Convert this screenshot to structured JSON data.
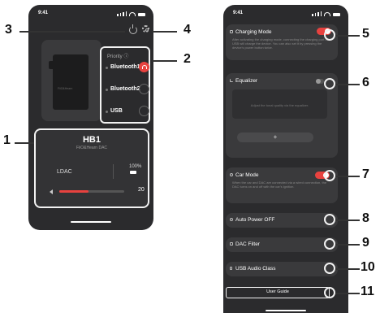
{
  "left_phone": {
    "status_time": "9:41",
    "priority_title": "Priority ⓘ",
    "priority_items": [
      "Bluetooth1",
      "Bluetooth2",
      "USB"
    ],
    "device": {
      "model": "HB1",
      "brand": "FiiO&Hearn DAC",
      "codec": "LDAC",
      "battery": "100%",
      "volume": "20",
      "volume_fraction": 0.45,
      "device_label": "FiiO&Hearn"
    }
  },
  "right_phone": {
    "status_time": "9:41",
    "charging": {
      "title": "Charging Mode",
      "desc": "After activating the charging mode, connecting the charging port or USB will charge the device. You can also set it by pressing the device's power button twice."
    },
    "equalizer": {
      "title": "Equalizer",
      "hint": "Adjust the tonal quality via the equalizer.",
      "add": "+"
    },
    "car_mode": {
      "title": "Car Mode",
      "desc": "When the car and DAC are connected via a wired connection, the DAC turns on and off with the car's ignition."
    },
    "auto_power_off": "Auto Power OFF",
    "dac_filter": "DAC Filter",
    "usb_audio_class": "USB Audio Class",
    "user_guide": "User Guide"
  },
  "callouts": [
    "1",
    "2",
    "3",
    "4",
    "5",
    "6",
    "7",
    "8",
    "9",
    "10",
    "11"
  ],
  "colors": {
    "accent": "#e8423f",
    "phone_bg": "#2b2b2d",
    "card_bg": "#3a3a3c"
  }
}
